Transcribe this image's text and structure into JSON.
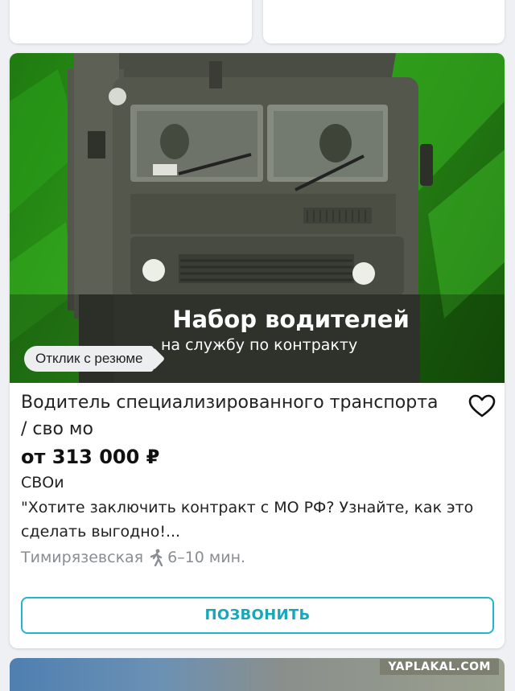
{
  "listing": {
    "hero_title": "Набор водителей",
    "hero_subtitle": "на службу по контракту",
    "badge": "Отклик с резюме",
    "title": "Водитель специализированного транспорта / сво мо",
    "salary": "от 313 000 ₽",
    "company": "СВОи",
    "description": "\"Хотите заключить контракт с МО РФ? Узнайте, как это сделать выгодно!...",
    "metro": "Тимирязевская",
    "travel_time": "6–10 мин.",
    "call_button": "ПОЗВОНИТЬ",
    "favorite_icon": "heart-outline-icon",
    "walk_icon": "walking-person-icon"
  },
  "watermark": "YAPLAKAL.COM",
  "colors": {
    "accent": "#22b6c9",
    "hero_green": "#2e9a1a",
    "muted_text": "#8a8d93"
  }
}
